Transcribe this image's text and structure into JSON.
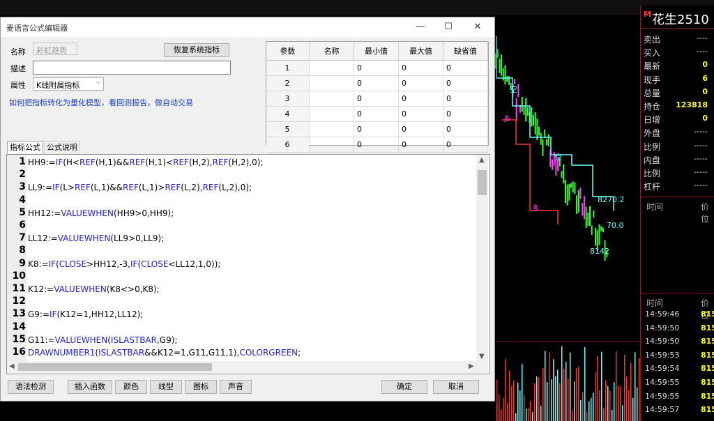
{
  "dialog": {
    "title": "麦语言公式编辑器",
    "window_buttons": {
      "minimize": "—",
      "maximize": "☐",
      "close": "✕"
    },
    "name_label": "名称",
    "name_value": "彩虹趋势",
    "restore_button": "恢复系统指标",
    "desc_label": "描述",
    "desc_value": "",
    "attr_label": "属性",
    "attr_value": "K线附属指标",
    "link_text": "如何把指标转化为量化模型，看回测报告，做自动交易",
    "params_table": {
      "headers": [
        "参数",
        "名称",
        "最小值",
        "最大值",
        "缺省值"
      ],
      "rows": [
        [
          "1",
          "",
          "0",
          "0",
          "0"
        ],
        [
          "2",
          "",
          "0",
          "0",
          "0"
        ],
        [
          "3",
          "",
          "0",
          "0",
          "0"
        ],
        [
          "4",
          "",
          "0",
          "0",
          "0"
        ],
        [
          "5",
          "",
          "0",
          "0",
          "0"
        ],
        [
          "6",
          "",
          "0",
          "0",
          "0"
        ]
      ]
    },
    "tabs": [
      "指标公式",
      "公式说明"
    ],
    "line_numbers": [
      "1",
      "2",
      "3",
      "4",
      "5",
      "6",
      "7",
      "8",
      "9",
      "10",
      "11",
      "12",
      "13",
      "14",
      "15",
      "16"
    ],
    "code_lines": [
      [
        [
          "HH9:=",
          ""
        ],
        [
          "IF",
          "fn"
        ],
        [
          "(H<",
          ""
        ],
        [
          "REF",
          "fn"
        ],
        [
          "(H,1)&&",
          ""
        ],
        [
          "REF",
          "fn"
        ],
        [
          "(H,1)<",
          ""
        ],
        [
          "REF",
          "fn"
        ],
        [
          "(H,2),",
          ""
        ],
        [
          "REF",
          "fn"
        ],
        [
          "(H,2),0);",
          ""
        ]
      ],
      [],
      [
        [
          "LL9:=",
          ""
        ],
        [
          "IF",
          "fn"
        ],
        [
          "(L>",
          ""
        ],
        [
          "REF",
          "fn"
        ],
        [
          "(L,1)&&",
          ""
        ],
        [
          "REF",
          "fn"
        ],
        [
          "(L,1)>",
          ""
        ],
        [
          "REF",
          "fn"
        ],
        [
          "(L,2),",
          ""
        ],
        [
          "REF",
          "fn"
        ],
        [
          "(L,2),0);",
          ""
        ]
      ],
      [],
      [
        [
          "HH12:=",
          ""
        ],
        [
          "VALUEWHEN",
          "fn"
        ],
        [
          "(HH9>0,HH9);",
          ""
        ]
      ],
      [],
      [
        [
          "LL12:=",
          ""
        ],
        [
          "VALUEWHEN",
          "fn"
        ],
        [
          "(LL9>0,LL9);",
          ""
        ]
      ],
      [],
      [
        [
          "K8:=",
          ""
        ],
        [
          "IF",
          "fn"
        ],
        [
          "(",
          ""
        ],
        [
          "CLOSE",
          "fn"
        ],
        [
          ">HH12,-3,",
          ""
        ],
        [
          "IF",
          "fn"
        ],
        [
          "(",
          ""
        ],
        [
          "CLOSE",
          "fn"
        ],
        [
          "<LL12,1,0));",
          ""
        ]
      ],
      [],
      [
        [
          "K12:=",
          ""
        ],
        [
          "VALUEWHEN",
          "fn"
        ],
        [
          "(K8<>0,K8);",
          ""
        ]
      ],
      [],
      [
        [
          "G9:=",
          ""
        ],
        [
          "IF",
          "fn"
        ],
        [
          "(K12=1,HH12,LL12);",
          ""
        ]
      ],
      [],
      [
        [
          "G11:=",
          ""
        ],
        [
          "VALUEWHEN",
          "fn"
        ],
        [
          "(",
          ""
        ],
        [
          "ISLASTBAR",
          "fn"
        ],
        [
          ",G9);",
          ""
        ]
      ],
      [
        [
          "DRAWNUMBER1",
          "fn"
        ],
        [
          "(",
          ""
        ],
        [
          "ISLASTBAR",
          "fn"
        ],
        [
          "&&K12=1,G11,G11,1),",
          ""
        ],
        [
          "COLORGREEN",
          "fn"
        ],
        [
          ";",
          ""
        ]
      ]
    ],
    "bottom_buttons": {
      "syntax_check": "语法检测",
      "insert_function": "插入函数",
      "color": "颜色",
      "line_type": "线型",
      "icon": "图标",
      "sound": "声音",
      "ok": "确定",
      "cancel": "取消"
    }
  },
  "quote_panel": {
    "marker": "M",
    "contract": "花生2510",
    "rows": [
      {
        "label": "卖出",
        "value": "----"
      },
      {
        "label": "买入",
        "value": "----"
      },
      {
        "label": "最新",
        "value": "0"
      },
      {
        "label": "现手",
        "value": "6"
      },
      {
        "label": "总量",
        "value": "0"
      },
      {
        "label": "持仓",
        "value": "123818"
      },
      {
        "label": "日增",
        "value": "0"
      },
      {
        "label": "外盘",
        "value": "-----"
      },
      {
        "label": "比例",
        "value": "-----"
      },
      {
        "label": "内盘",
        "value": "-----"
      },
      {
        "label": "比例",
        "value": "-----"
      },
      {
        "label": "杠杆",
        "value": "-----"
      }
    ],
    "time_header_1": "时间",
    "price_header_1": "价位",
    "time_header_2": "时间",
    "price_header_2": "价位",
    "ticks": [
      {
        "time": "14:59:46",
        "price": "815"
      },
      {
        "time": "14:59:50",
        "price": "815"
      },
      {
        "time": "14:59:50",
        "price": "815"
      },
      {
        "time": "14:59:53",
        "price": "815"
      },
      {
        "time": "14:59:54",
        "price": "815"
      },
      {
        "time": "14:59:55",
        "price": "815"
      },
      {
        "time": "14:59:55",
        "price": "815"
      },
      {
        "time": "14:59:57",
        "price": "815"
      }
    ]
  },
  "chart_labels": {
    "level_high": "8270.2",
    "level_mid": "70.0",
    "level_low": "8142",
    "mark_kong_1": "空",
    "mark_kong_2": "空",
    "mark_duo_1": "多",
    "mark_duo_2": "多"
  },
  "colors": {
    "up_candle": "#33ff33",
    "down_candle": "#ff40ff",
    "line_cyan": "#66ffff",
    "dialog_bg": "#f0f0f0",
    "code_function": "#1f1fd6",
    "tick_price": "#ffff00"
  }
}
